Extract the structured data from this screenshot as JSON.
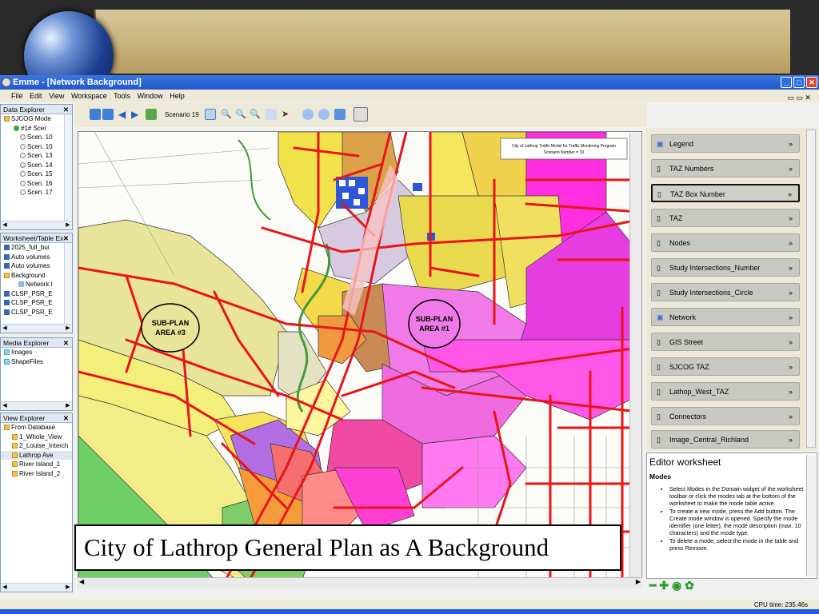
{
  "window": {
    "title": "Emme - [Network Background]",
    "menu": [
      "File",
      "Edit",
      "View",
      "Workspace",
      "Tools",
      "Window",
      "Help"
    ]
  },
  "data_explorer": {
    "title": "Data Explorer",
    "items": [
      "SJCOG Mode",
      "#1# Scer",
      "Scen. 10",
      "Scen. 10",
      "Scen. 13",
      "Scen. 14",
      "Scen. 15",
      "Scen. 16",
      "Scen. 17"
    ]
  },
  "worksheet_explorer": {
    "title": "Worksheet/Table Ex",
    "items": [
      "2025_full_bui",
      "Auto volumes",
      "Auto volumes",
      "Background",
      "Network I",
      "CLSP_PSR_E",
      "CLSP_PSR_E",
      "CLSP_PSR_E"
    ]
  },
  "media_explorer": {
    "title": "Media Explorer",
    "items": [
      "Images",
      "ShapeFiles"
    ]
  },
  "view_explorer": {
    "title": "View Explorer",
    "items": [
      "From Database",
      "1_Whole_View",
      "2_Louise_Interch",
      "Lathrop Ave",
      "River Island_1",
      "River Island_2"
    ]
  },
  "toolbar": {
    "scenario_label": "Scenario 19"
  },
  "map": {
    "legend_box_line1": "City of Lathrop Traffic Model for Traffic Monitoring Program",
    "legend_box_line2": "Scenario Number = 19",
    "labels": {
      "subplan1_a": "SUB-PLAN",
      "subplan1_b": "AREA #1",
      "subplan3_a": "SUB-PLAN",
      "subplan3_b": "AREA #3"
    }
  },
  "caption": "City of Lathrop General Plan as A Background",
  "layers": [
    {
      "label": "Legend"
    },
    {
      "label": "TAZ Numbers"
    },
    {
      "label": "TAZ Box Number"
    },
    {
      "label": "TAZ"
    },
    {
      "label": "Nodes"
    },
    {
      "label": "Study Intersections_Number"
    },
    {
      "label": "Study Intersections_Circle"
    },
    {
      "label": "Network"
    },
    {
      "label": "GIS Street"
    },
    {
      "label": "SJCOG TAZ"
    },
    {
      "label": "Lathop_West_TAZ"
    },
    {
      "label": "Connectors"
    },
    {
      "label": "Image_Central_Richland"
    }
  ],
  "editor": {
    "title": "Editor worksheet",
    "subtitle": "Modes",
    "bullets": [
      "Select Modes in the Domain widget of the worksheet toolbar or click the modes tab at the bottom of the worksheet to make the mode table active.",
      "To create a new mode, press the Add button. The Create mode window is opened. Specify the mode identifier (one letter), the mode description (max. 10 characters) and the mode type.",
      "To delete a mode, select the mode in the table and press Remove."
    ]
  },
  "status": {
    "cpu_time": "CPU time: 235.46s"
  }
}
